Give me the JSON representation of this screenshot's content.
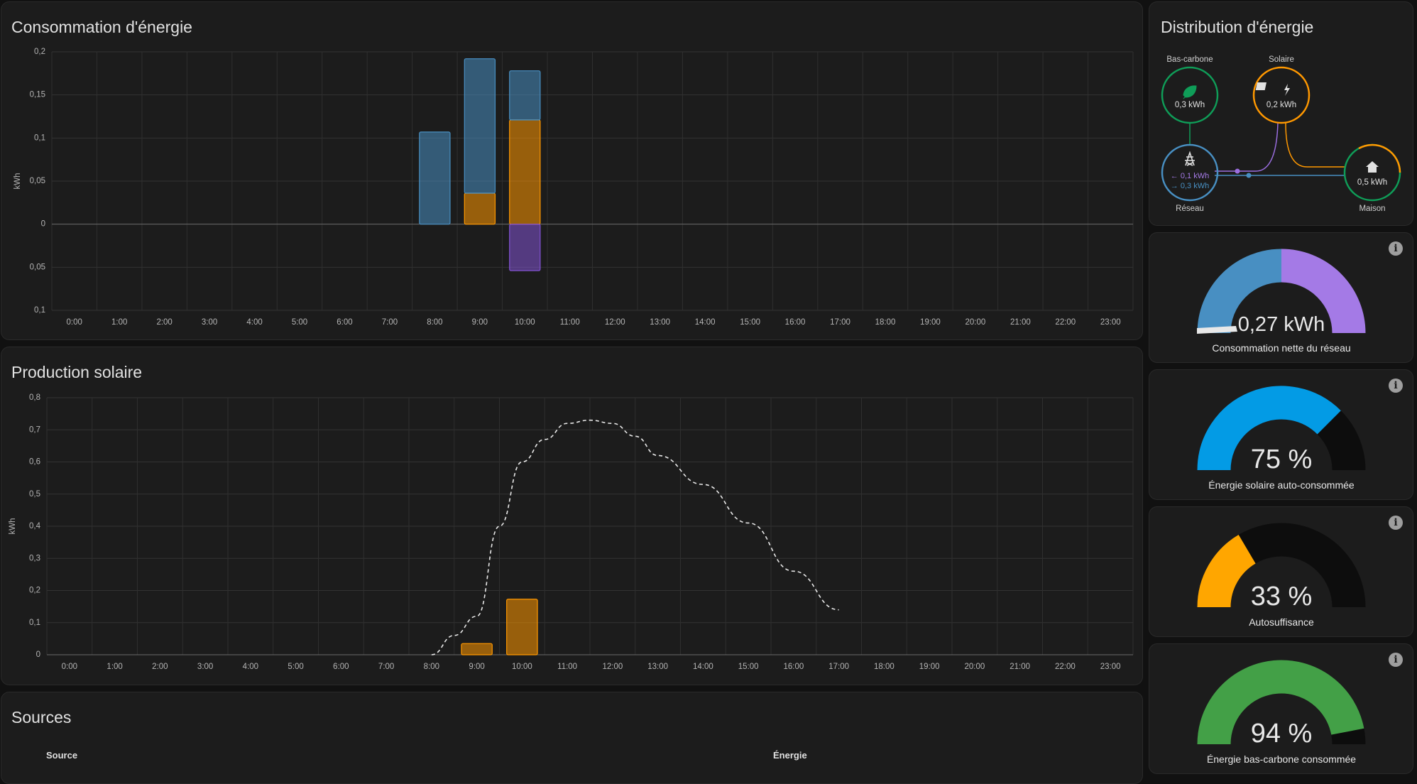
{
  "consumption": {
    "title": "Consommation d'énergie",
    "ylabel": "kWh"
  },
  "solar": {
    "title": "Production solaire",
    "ylabel": "kWh"
  },
  "sources": {
    "title": "Sources",
    "col_source": "Source",
    "col_energy": "Énergie"
  },
  "distribution": {
    "title": "Distribution d'énergie",
    "low_carbon": {
      "label": "Bas-carbone",
      "value": "0,3 kWh"
    },
    "solar": {
      "label": "Solaire",
      "value": "0,2 kWh"
    },
    "grid": {
      "label": "Réseau",
      "in_value": "← 0,1 kWh",
      "out_value": "→ 0,3 kWh"
    },
    "home": {
      "label": "Maison",
      "value": "0,5 kWh"
    }
  },
  "gauges": [
    {
      "value": "0,27 kWh",
      "label": "Consommation nette du réseau"
    },
    {
      "value": "75 %",
      "label": "Énergie solaire auto-consommée",
      "fraction": 0.75,
      "color": "#039be5"
    },
    {
      "value": "33 %",
      "label": "Autosuffisance",
      "fraction": 0.33,
      "color": "#ffa600"
    },
    {
      "value": "94 %",
      "label": "Énergie bas-carbone consommée",
      "fraction": 0.94,
      "color": "#43a047"
    }
  ],
  "chart_data": [
    {
      "type": "bar",
      "title": "Consommation d'énergie",
      "ylabel": "kWh",
      "yticks": [
        "0,2",
        "0,15",
        "0,1",
        "0,05",
        "0",
        "0,05",
        "0,1"
      ],
      "ylim": [
        -0.1,
        0.2
      ],
      "categories": [
        "0:00",
        "1:00",
        "2:00",
        "3:00",
        "4:00",
        "5:00",
        "6:00",
        "7:00",
        "8:00",
        "9:00",
        "10:00",
        "11:00",
        "12:00",
        "13:00",
        "14:00",
        "15:00",
        "16:00",
        "17:00",
        "18:00",
        "19:00",
        "20:00",
        "21:00",
        "22:00",
        "23:00"
      ],
      "series": [
        {
          "color": "#ff9800",
          "values": [
            0,
            0,
            0,
            0,
            0,
            0,
            0,
            0,
            0,
            0.036,
            0.121,
            0,
            0,
            0,
            0,
            0,
            0,
            0,
            0,
            0,
            0,
            0,
            0,
            0
          ]
        },
        {
          "color": "#488fc2",
          "values": [
            0,
            0,
            0,
            0,
            0,
            0,
            0,
            0,
            0.107,
            0.156,
            0.057,
            0,
            0,
            0,
            0,
            0,
            0,
            0,
            0,
            0,
            0,
            0,
            0,
            0
          ]
        },
        {
          "color": "#8353d4",
          "values": [
            0,
            0,
            0,
            0,
            0,
            0,
            0,
            0,
            0,
            0,
            -0.054,
            0,
            0,
            0,
            0,
            0,
            0,
            0,
            0,
            0,
            0,
            0,
            0,
            0
          ]
        }
      ]
    },
    {
      "type": "bar",
      "title": "Production solaire",
      "ylabel": "kWh",
      "yticks": [
        "0,8",
        "0,7",
        "0,6",
        "0,5",
        "0,4",
        "0,3",
        "0,2",
        "0,1",
        "0"
      ],
      "ylim": [
        0,
        0.8
      ],
      "categories": [
        "0:00",
        "1:00",
        "2:00",
        "3:00",
        "4:00",
        "5:00",
        "6:00",
        "7:00",
        "8:00",
        "9:00",
        "10:00",
        "11:00",
        "12:00",
        "13:00",
        "14:00",
        "15:00",
        "16:00",
        "17:00",
        "18:00",
        "19:00",
        "20:00",
        "21:00",
        "22:00",
        "23:00"
      ],
      "series": [
        {
          "color": "#ff9800",
          "values": [
            0,
            0,
            0,
            0,
            0,
            0,
            0,
            0,
            0,
            0.035,
            0.173,
            0,
            0,
            0,
            0,
            0,
            0,
            0,
            0,
            0,
            0,
            0,
            0,
            0
          ]
        }
      ],
      "forecast": {
        "style": "dashed",
        "x": [
          8,
          8.5,
          9,
          9.5,
          10,
          10.5,
          11,
          11.5,
          12,
          12.5,
          13,
          14,
          15,
          16,
          17
        ],
        "y": [
          0,
          0.06,
          0.12,
          0.4,
          0.6,
          0.67,
          0.72,
          0.73,
          0.72,
          0.68,
          0.62,
          0.53,
          0.41,
          0.26,
          0.14
        ]
      }
    }
  ]
}
